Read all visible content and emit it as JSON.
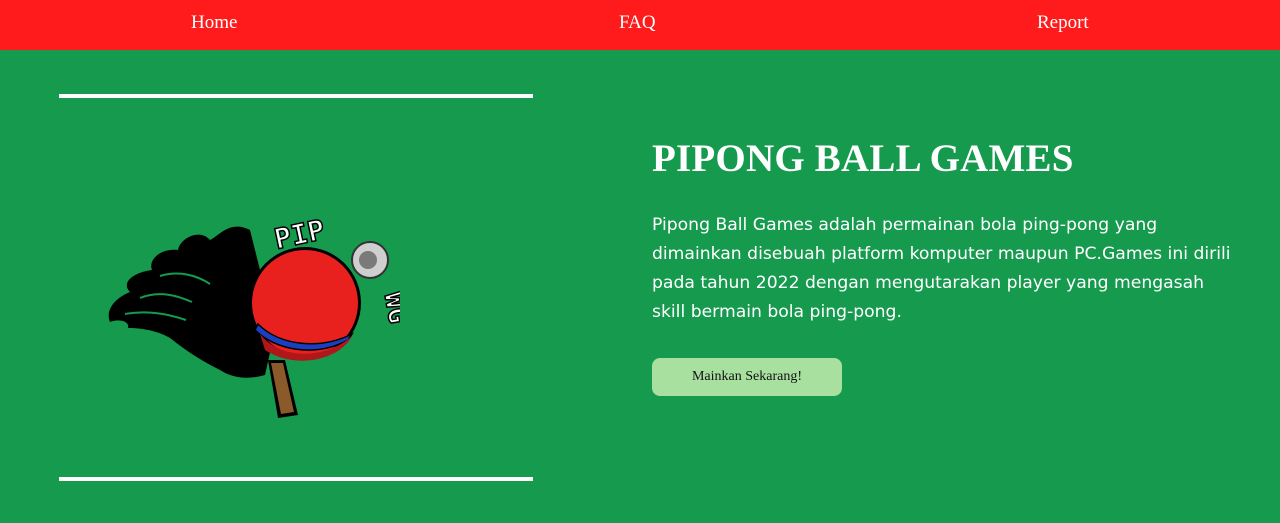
{
  "nav": {
    "home": "Home",
    "faq": "FAQ",
    "report": "Report"
  },
  "logo": {
    "icon": "pingpong-paddle-flame-logo",
    "text_top": "PIP",
    "text_side": "WG"
  },
  "hero": {
    "title": "PIPONG BALL GAMES",
    "description": "Pipong Ball Games adalah permainan bola ping-pong yang dimainkan disebuah platform komputer maupun PC.Games ini dirili pada tahun 2022 dengan mengutarakan player yang mengasah skill bermain bola ping-pong.",
    "button_label": "Mainkan Sekarang!"
  },
  "colors": {
    "navbar": "#ff1b1b",
    "background": "#169a4e",
    "button": "#a8e0a0",
    "paddle": "#e8211f",
    "handle": "#8a5a2b",
    "stripe": "#1a3fc0"
  }
}
